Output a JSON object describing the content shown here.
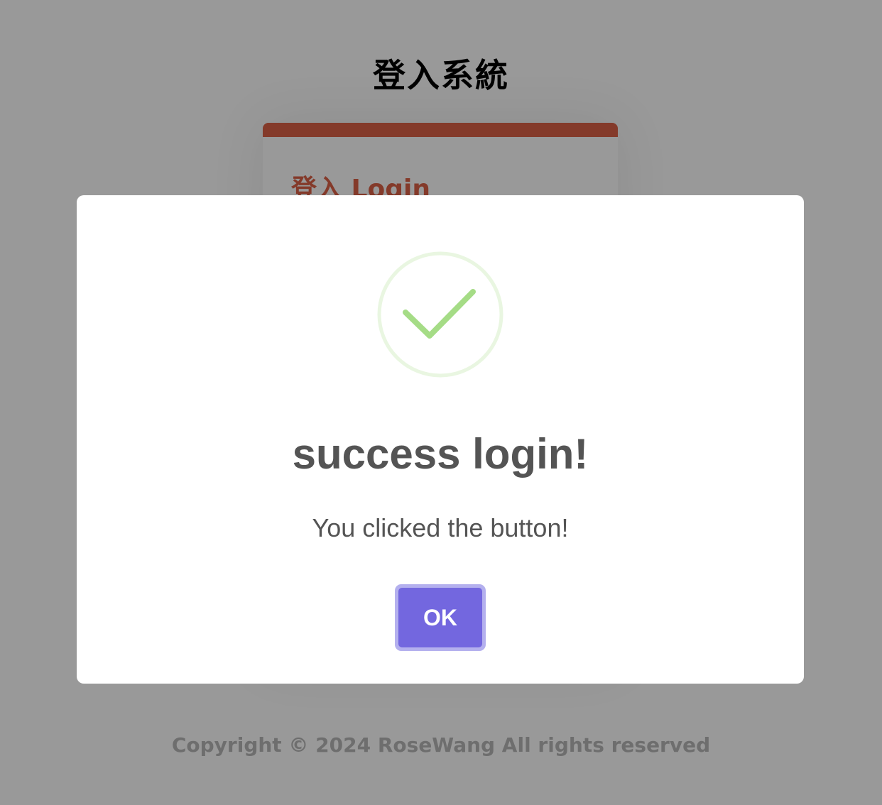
{
  "page": {
    "title": "登入系統",
    "copyright": "Copyright © 2024 RoseWang All rights reserved"
  },
  "login_card": {
    "heading": "登入 Login"
  },
  "modal": {
    "icon": "success-check-icon",
    "title": "success login!",
    "text": "You clicked the button!",
    "ok_label": "OK"
  },
  "colors": {
    "overlay_background": "#999999",
    "card_accent": "#843a2a",
    "button": "#7367df",
    "button_focus_ring": "#b4b0ee",
    "success_icon": "#a5dc86",
    "success_ring": "#e9f6e1",
    "modal_text": "#545454"
  }
}
